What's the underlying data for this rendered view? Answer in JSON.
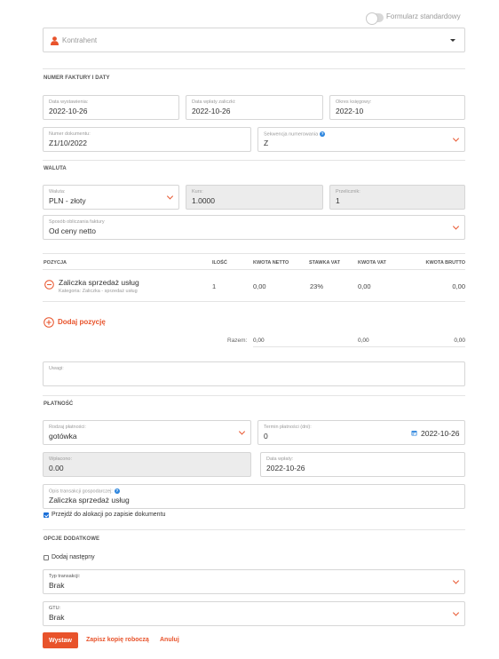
{
  "header": {
    "toggle_label": "Formularz standardowy"
  },
  "contractor": {
    "placeholder": "Kontrahent"
  },
  "sections": {
    "invoice": "NUMER FAKTURY I DATY",
    "currency": "WALUTA",
    "payment": "PŁATNOŚĆ",
    "options": "OPCJE DODATKOWE"
  },
  "invoice": {
    "issue_date": {
      "label": "Data wystawienia:",
      "value": "2022-10-26"
    },
    "advance_date": {
      "label": "Data wpłaty zaliczki:",
      "value": "2022-10-26"
    },
    "period": {
      "label": "Okres księgowy:",
      "value": "2022-10"
    },
    "doc_number": {
      "label": "Numer dokumentu:",
      "value": "Z1/10/2022"
    },
    "sequence": {
      "label": "Sekwencja numerowania",
      "value": "Z"
    }
  },
  "currency": {
    "currency": {
      "label": "Waluta:",
      "value": "PLN - złoty"
    },
    "rate": {
      "label": "Kurs:",
      "value": "1.0000"
    },
    "factor": {
      "label": "Przelicznik:",
      "value": "1"
    },
    "calc_method": {
      "label": "Sposób obliczania faktury",
      "value": "Od ceny netto"
    }
  },
  "positions": {
    "headers": {
      "position": "POZYCJA",
      "qty": "ILOŚĆ",
      "net": "KWOTA NETTO",
      "vat_rate": "STAWKA VAT",
      "vat_amount": "KWOTA VAT",
      "gross": "KWOTA BRUTTO"
    },
    "rows": [
      {
        "name": "Zaliczka sprzedaż usług",
        "category": "Kategoria: Zaliczka - sprzedaż usług",
        "qty": "1",
        "net": "0,00",
        "vat_rate": "23%",
        "vat_amount": "0,00",
        "gross": "0,00"
      }
    ],
    "add_label": "Dodaj pozycję",
    "total_label": "Razem:",
    "total_net": "0,00",
    "total_vat": "0,00",
    "total_gross": "0,00"
  },
  "notes": {
    "label": "Uwagi:",
    "value": ""
  },
  "payment": {
    "method": {
      "label": "Rodzaj płatności:",
      "value": "gotówka"
    },
    "term": {
      "label": "Termin płatności (dni):",
      "value": "0",
      "date": "2022-10-26"
    },
    "paid": {
      "label": "Wpłacono:",
      "value": "0.00"
    },
    "payment_date": {
      "label": "Data wpłaty:",
      "value": "2022-10-26"
    },
    "description": {
      "label": "Opis transakcji gospodarczej:",
      "value": "Zaliczka sprzedaż usług"
    },
    "go_to_allocation": "Przejdź do alokacji po zapisie dokumentu"
  },
  "options": {
    "add_next": "Dodaj następny",
    "transaction_type": {
      "label": "Typ transakcji:",
      "value": "Brak"
    },
    "gtu": {
      "label": "GTU:",
      "value": "Brak"
    }
  },
  "actions": {
    "issue": "Wystaw",
    "save_draft": "Zapisz kopię roboczą",
    "cancel": "Anuluj"
  },
  "colors": {
    "accent": "#e8532b",
    "help": "#2e86de",
    "disabled_bg": "#ececec"
  },
  "icons": [
    "person-icon",
    "chevron-down-icon",
    "remove-circle-icon",
    "add-circle-icon",
    "calendar-icon",
    "help-icon",
    "checkbox-icon"
  ]
}
